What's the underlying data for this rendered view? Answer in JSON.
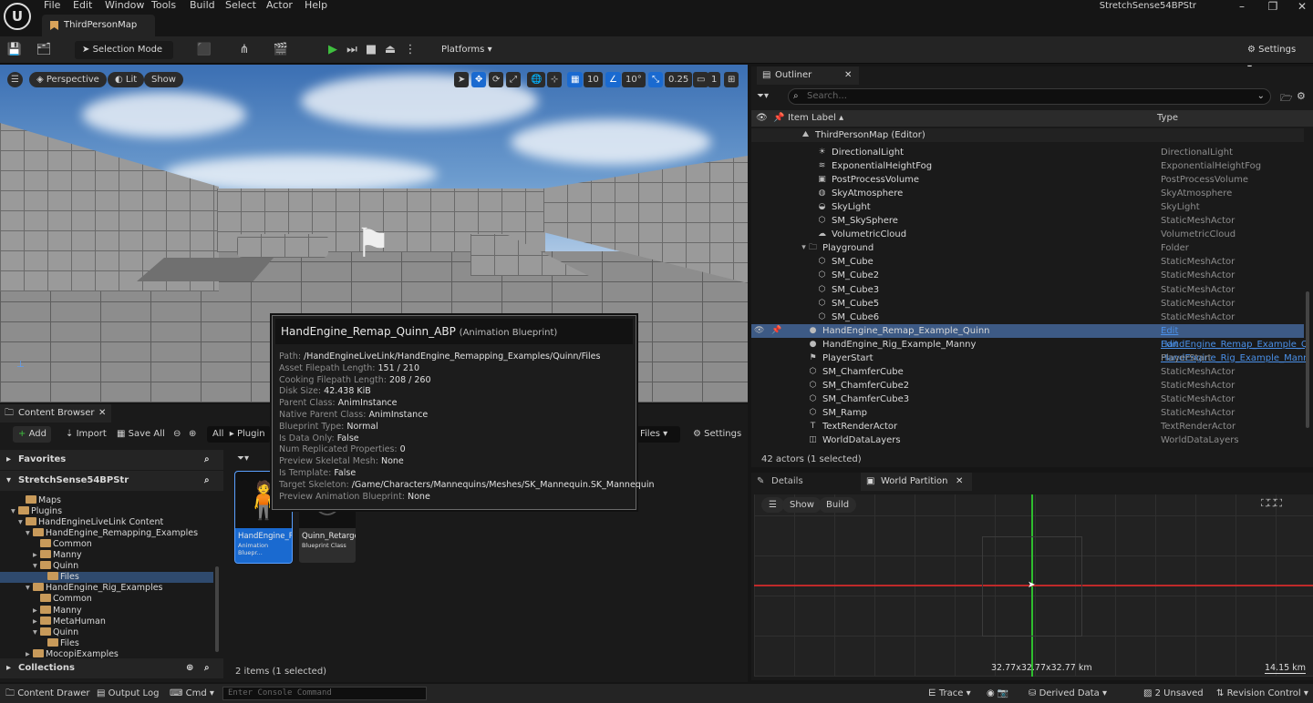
{
  "titlebar": {
    "menu": [
      "File",
      "Edit",
      "Window",
      "Tools",
      "Build",
      "Select",
      "Actor",
      "Help"
    ],
    "project_name": "StretchSense54BPStr",
    "map_tab": "ThirdPersonMap"
  },
  "toolbar": {
    "selection_mode": "Selection Mode",
    "platforms": "Platforms",
    "settings": "Settings"
  },
  "viewport": {
    "perspective": "Perspective",
    "lit": "Lit",
    "show": "Show",
    "grid_snap": "10",
    "rot_snap": "10°",
    "scale_snap": "0.25",
    "camera_speed": "1"
  },
  "tooltip": {
    "title": "HandEngine_Remap_Quinn_ABP",
    "subtitle": "(Animation Blueprint)",
    "rows": [
      {
        "k": "Path: ",
        "v": "/HandEngineLiveLink/HandEngine_Remapping_Examples/Quinn/Files"
      },
      {
        "k": "Asset Filepath Length: ",
        "v": "151 / 210"
      },
      {
        "k": "Cooking Filepath Length: ",
        "v": "208 / 260"
      },
      {
        "k": "Disk Size: ",
        "v": "42.438 KiB"
      },
      {
        "k": "Parent Class: ",
        "v": "AnimInstance"
      },
      {
        "k": "Native Parent Class: ",
        "v": "AnimInstance"
      },
      {
        "k": "Blueprint Type: ",
        "v": "Normal"
      },
      {
        "k": "Is Data Only: ",
        "v": "False"
      },
      {
        "k": "Num Replicated Properties: ",
        "v": "0"
      },
      {
        "k": "Preview Skeletal Mesh: ",
        "v": "None"
      },
      {
        "k": "Is Template: ",
        "v": "False"
      },
      {
        "k": "Target Skeleton: ",
        "v": "/Game/Characters/Mannequins/Meshes/SK_Mannequin.SK_Mannequin"
      },
      {
        "k": "Preview Animation Blueprint: ",
        "v": "None"
      }
    ]
  },
  "outliner": {
    "tab": "Outliner",
    "search_placeholder": "Search...",
    "col_label": "Item Label",
    "col_type": "Type",
    "root": "ThirdPersonMap (Editor)",
    "rows": [
      {
        "label": "DirectionalLight",
        "type": "DirectionalLight",
        "indent": 2,
        "icon": "sun-icon"
      },
      {
        "label": "ExponentialHeightFog",
        "type": "ExponentialHeightFog",
        "indent": 2,
        "icon": "fog-icon"
      },
      {
        "label": "PostProcessVolume",
        "type": "PostProcessVolume",
        "indent": 2,
        "icon": "volume-icon"
      },
      {
        "label": "SkyAtmosphere",
        "type": "SkyAtmosphere",
        "indent": 2,
        "icon": "atmosphere-icon"
      },
      {
        "label": "SkyLight",
        "type": "SkyLight",
        "indent": 2,
        "icon": "skylight-icon"
      },
      {
        "label": "SM_SkySphere",
        "type": "StaticMeshActor",
        "indent": 2,
        "icon": "mesh-icon"
      },
      {
        "label": "VolumetricCloud",
        "type": "VolumetricCloud",
        "indent": 2,
        "icon": "cloud-icon"
      },
      {
        "label": "Playground",
        "type": "Folder",
        "indent": 1,
        "icon": "folder-icon"
      },
      {
        "label": "SM_Cube",
        "type": "StaticMeshActor",
        "indent": 2,
        "icon": "mesh-icon"
      },
      {
        "label": "SM_Cube2",
        "type": "StaticMeshActor",
        "indent": 2,
        "icon": "mesh-icon"
      },
      {
        "label": "SM_Cube3",
        "type": "StaticMeshActor",
        "indent": 2,
        "icon": "mesh-icon"
      },
      {
        "label": "SM_Cube5",
        "type": "StaticMeshActor",
        "indent": 2,
        "icon": "mesh-icon"
      },
      {
        "label": "SM_Cube6",
        "type": "StaticMeshActor",
        "indent": 2,
        "icon": "mesh-icon"
      },
      {
        "label": "HandEngine_Remap_Example_Quinn",
        "type": "Edit HandEngine_Remap_Example_Q",
        "indent": 1,
        "icon": "character-icon",
        "selected": true,
        "link": true
      },
      {
        "label": "HandEngine_Rig_Example_Manny",
        "type": "Edit HandEngine_Rig_Example_Mann",
        "indent": 1,
        "icon": "character-icon",
        "link": true
      },
      {
        "label": "PlayerStart",
        "type": "PlayerStart",
        "indent": 1,
        "icon": "playerstart-icon"
      },
      {
        "label": "SM_ChamferCube",
        "type": "StaticMeshActor",
        "indent": 1,
        "icon": "mesh-icon"
      },
      {
        "label": "SM_ChamferCube2",
        "type": "StaticMeshActor",
        "indent": 1,
        "icon": "mesh-icon"
      },
      {
        "label": "SM_ChamferCube3",
        "type": "StaticMeshActor",
        "indent": 1,
        "icon": "mesh-icon"
      },
      {
        "label": "SM_Ramp",
        "type": "StaticMeshActor",
        "indent": 1,
        "icon": "mesh-icon"
      },
      {
        "label": "TextRenderActor",
        "type": "TextRenderActor",
        "indent": 1,
        "icon": "text-icon"
      },
      {
        "label": "WorldDataLayers",
        "type": "WorldDataLayers",
        "indent": 1,
        "icon": "layers-icon"
      }
    ],
    "actor_count": "42 actors (1 selected)"
  },
  "details": {
    "tab_details": "Details",
    "tab_world_partition": "World Partition",
    "show": "Show",
    "build": "Build",
    "size_readout": "32.77x32.77x32.77 km",
    "scale_readout": "14.15 km"
  },
  "content_browser": {
    "tab": "Content Browser",
    "add": "Add",
    "import": "Import",
    "save_all": "Save All",
    "path_all": "All",
    "path_plugins": "Plugin",
    "path_files": "Files",
    "settings": "Settings",
    "favorites": "Favorites",
    "project": "StretchSense54BPStr",
    "collections": "Collections",
    "tree": [
      {
        "label": "Maps",
        "indent": 3,
        "arrow": ""
      },
      {
        "label": "Plugins",
        "indent": 2,
        "arrow": "▾"
      },
      {
        "label": "HandEngineLiveLink Content",
        "indent": 3,
        "arrow": "▾"
      },
      {
        "label": "HandEngine_Remapping_Examples",
        "indent": 4,
        "arrow": "▾"
      },
      {
        "label": "Common",
        "indent": 5,
        "arrow": ""
      },
      {
        "label": "Manny",
        "indent": 5,
        "arrow": "▸"
      },
      {
        "label": "Quinn",
        "indent": 5,
        "arrow": "▾"
      },
      {
        "label": "Files",
        "indent": 6,
        "arrow": "",
        "selected": true
      },
      {
        "label": "HandEngine_Rig_Examples",
        "indent": 4,
        "arrow": "▾"
      },
      {
        "label": "Common",
        "indent": 5,
        "arrow": ""
      },
      {
        "label": "Manny",
        "indent": 5,
        "arrow": "▸"
      },
      {
        "label": "MetaHuman",
        "indent": 5,
        "arrow": "▸"
      },
      {
        "label": "Quinn",
        "indent": 5,
        "arrow": "▾"
      },
      {
        "label": "Files",
        "indent": 6,
        "arrow": ""
      },
      {
        "label": "MocopiExamples",
        "indent": 4,
        "arrow": "▸"
      }
    ],
    "assets": [
      {
        "name": "HandEngine_Remap_Quinn",
        "type": "Animation Bluepr...",
        "selected": true
      },
      {
        "name": "Quinn_RetargetAsset",
        "type": "Blueprint Class",
        "selected": false
      }
    ],
    "item_count": "2 items (1 selected)"
  },
  "statusbar": {
    "content_drawer": "Content Drawer",
    "output_log": "Output Log",
    "cmd": "Cmd",
    "console_placeholder": "Enter Console Command",
    "trace": "Trace",
    "derived_data": "Derived Data",
    "unsaved": "2 Unsaved",
    "revision_control": "Revision Control"
  }
}
